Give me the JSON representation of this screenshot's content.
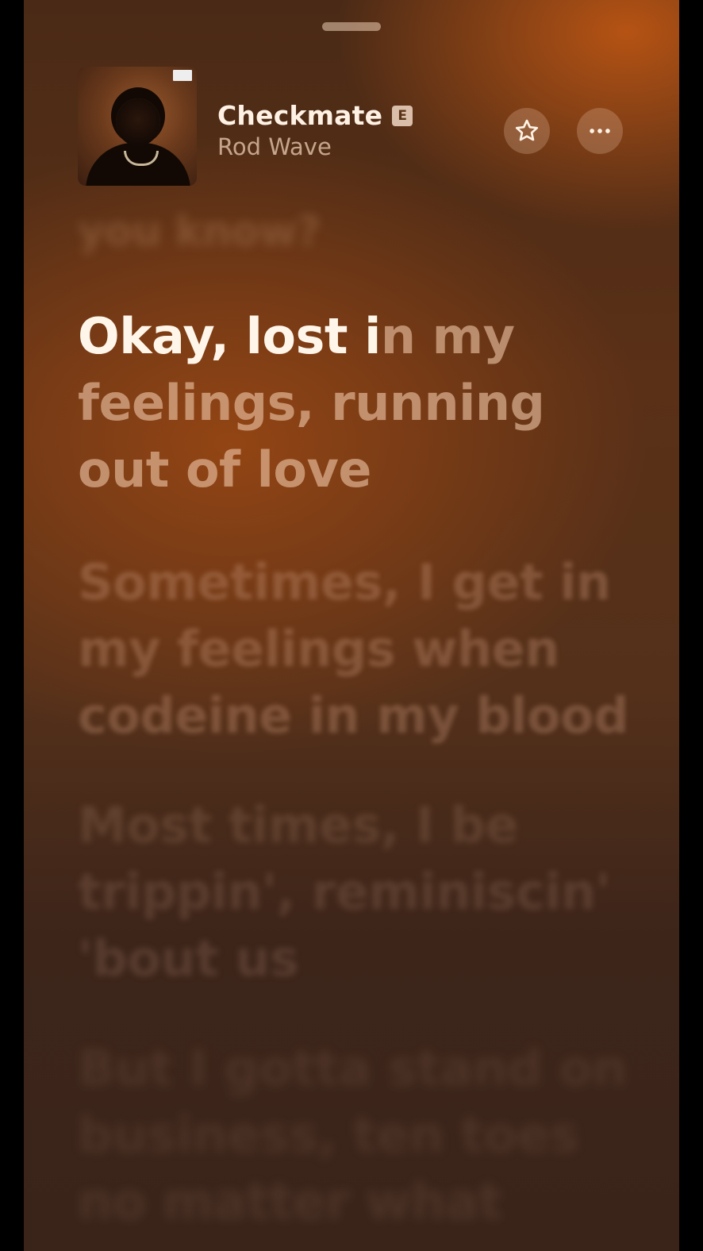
{
  "song": {
    "title": "Checkmate",
    "explicit_badge": "E",
    "artist": "Rod Wave"
  },
  "icons": {
    "favorite": "star-icon",
    "more": "ellipsis-icon"
  },
  "lyrics": {
    "previous_line": "you know?",
    "active_line_sung": "Okay, lost i",
    "active_line_unsung": "n my feelings, running out of love",
    "next_lines": [
      "Sometimes, I get in my feelings when codeine in my blood",
      "Most times, I be trippin', reminiscin' 'bout us",
      "But I gotta stand on business, ten toes no matter what"
    ]
  },
  "colors": {
    "accent": "#c8601a",
    "background_dark": "#3a241a"
  }
}
